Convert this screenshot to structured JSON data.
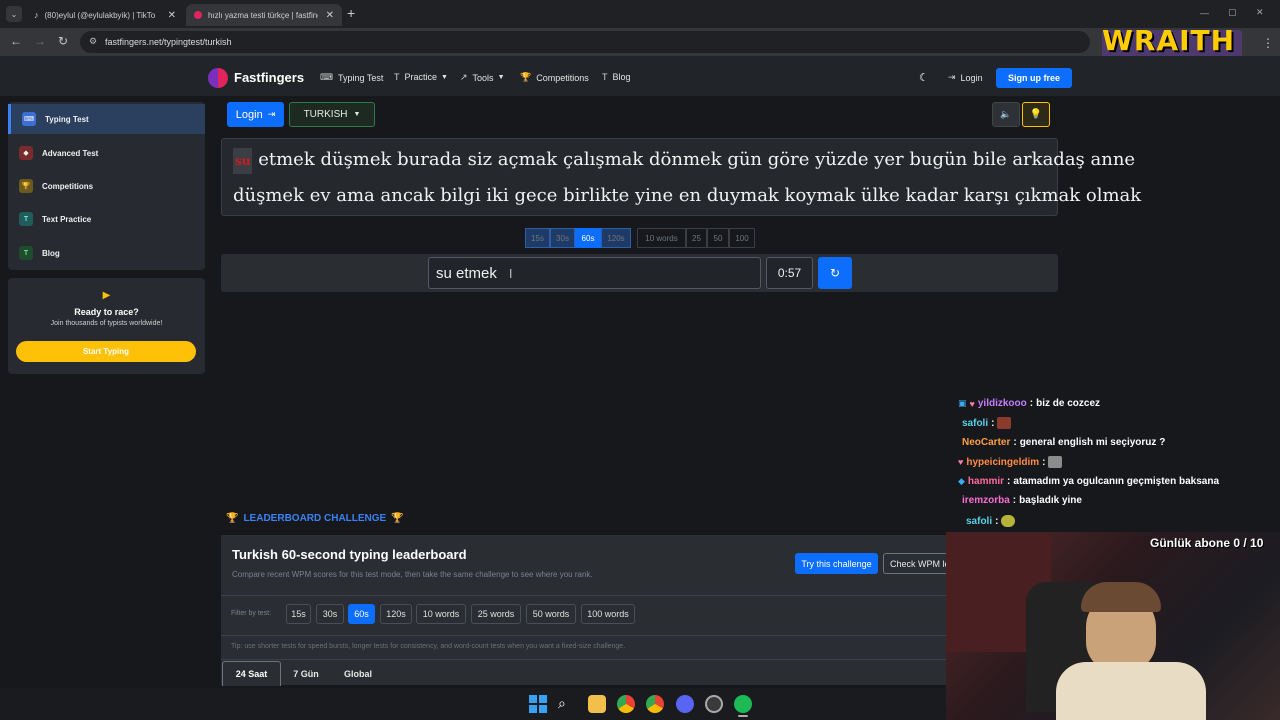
{
  "browser": {
    "tabs": [
      {
        "title": "(80)eylul (@eylulakbyik) | TikTok",
        "active": false
      },
      {
        "title": "hızlı yazma testi türkçe | fastfingers",
        "active": true
      }
    ],
    "new_tab": "+",
    "url": "fastfingers.net/typingtest/turkish"
  },
  "header": {
    "brand": "Fastfingers",
    "nav": [
      "Typing Test",
      "Practice",
      "Tools",
      "Competitions",
      "Blog"
    ],
    "login": "Login",
    "signup": "Sign up free"
  },
  "sidebar": {
    "items": [
      {
        "label": "Typing Test",
        "color": "#3b6fd6"
      },
      {
        "label": "Advanced Test",
        "color": "#a33b3b"
      },
      {
        "label": "Competitions",
        "color": "#c9a227"
      },
      {
        "label": "Text Practice",
        "color": "#2f8f8a"
      },
      {
        "label": "Blog",
        "color": "#2d7a46"
      }
    ],
    "race": {
      "title": "Ready to race?",
      "subtitle": "Join thousands of typists worldwide!",
      "button": "Start Typing"
    }
  },
  "test": {
    "login_button": "Login",
    "language": "TURKISH",
    "current_word": "su",
    "line1": "etmek düşmek burada siz açmak çalışmak dönmek gün göre yüzde yer bugün bile arkadaş anne",
    "line2": "düşmek ev ama ancak bilgi iki gece birlikte yine en duymak koymak ülke kadar karşı çıkmak olmak",
    "time_modes": [
      "15s",
      "30s",
      "60s",
      "120s"
    ],
    "word_modes": [
      "10 words",
      "25",
      "50",
      "100"
    ],
    "active_mode": "60s",
    "input_value": "su etmek",
    "timer": "0:57"
  },
  "leaderboard": {
    "heading": "LEADERBOARD CHALLENGE",
    "title": "Turkish 60-second typing leaderboard",
    "subtitle": "Compare recent WPM scores for this test mode, then take the same challenge to see where you rank.",
    "try_button": "Try this challenge",
    "check_button": "Check WPM le",
    "filter_label": "Filter by test:",
    "filters": [
      "15s",
      "30s",
      "60s",
      "120s",
      "10 words",
      "25 words",
      "50 words",
      "100 words"
    ],
    "active_filter": "60s",
    "tip": "Tip: use shorter tests for speed bursts, longer tests for consistency, and word-count tests when you want a fixed-size challenge.",
    "periods": [
      "24 Saat",
      "7 Gün",
      "Global"
    ],
    "active_period": "24 Saat"
  },
  "overlay": {
    "brand": "WRAITH",
    "sub_goal": "Günlük abone 0 / 10",
    "chat": [
      {
        "user": "yildizkooo",
        "sep": ":",
        "message": "biz de cozcez",
        "color": "#c77dff"
      },
      {
        "user": "safoli",
        "sep": ":",
        "message": "",
        "color": "#5ad1e6"
      },
      {
        "user": "NeoCarter",
        "sep": ":",
        "message": "general english mi seçiyoruz ?",
        "color": "#ff9f43"
      },
      {
        "user": "hypeicingeldim",
        "sep": ":",
        "message": "",
        "color": "#ff8c42"
      },
      {
        "user": "hammir",
        "sep": ":",
        "message": "atamadım ya ogulcanın geçmişten baksana",
        "color": "#ff6b9d"
      },
      {
        "user": "iremzorba",
        "sep": ":",
        "message": "başladık yine",
        "color": "#ff6bd6"
      },
      {
        "user": "safoli",
        "sep": ":",
        "message": "",
        "color": "#5ad1e6"
      }
    ]
  },
  "colors": {
    "accent": "#0d6efd",
    "yellow": "#ffc107",
    "bg": "#16181c"
  }
}
